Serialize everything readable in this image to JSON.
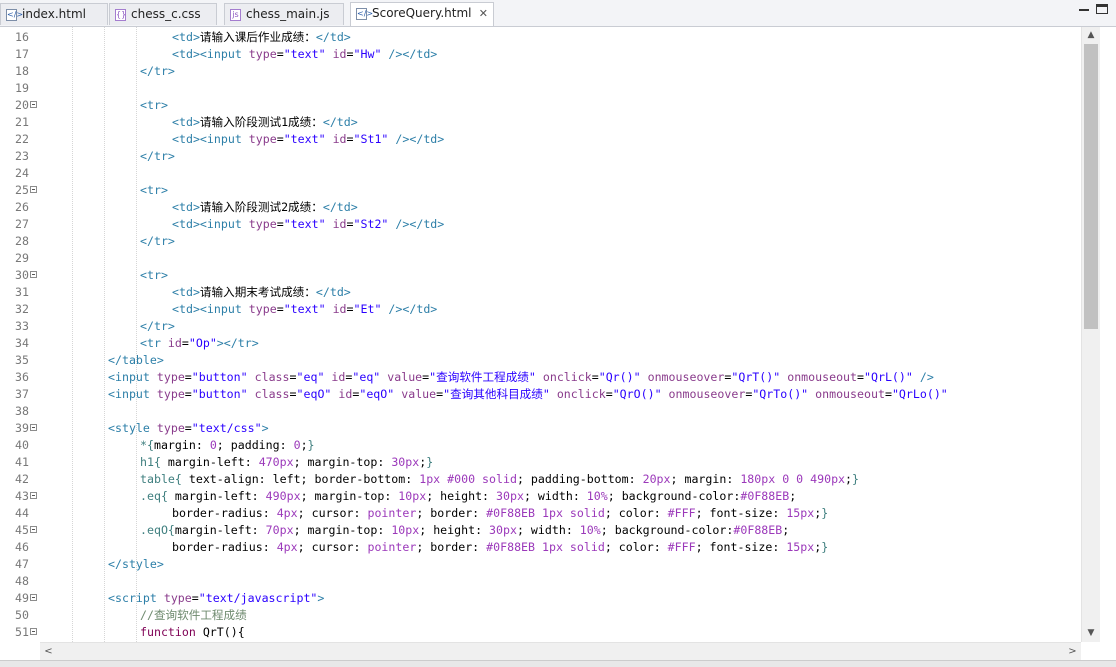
{
  "tabs": [
    {
      "label": "index.html",
      "icon": "html-file-icon"
    },
    {
      "label": "chess_c.css",
      "icon": "css-file-icon"
    },
    {
      "label": "chess_main.js",
      "icon": "js-file-icon"
    },
    {
      "label": "ScoreQuery.html",
      "icon": "html-file-icon",
      "active": true
    }
  ],
  "close_glyph": "✕",
  "scroll_up": "▲",
  "scroll_down": "▼",
  "scroll_left": "<",
  "scroll_right": ">",
  "lines": [
    {
      "n": "16",
      "fold": false,
      "indent": 4,
      "segs": [
        [
          "t",
          "<td>"
        ],
        [
          "tx",
          "请输入课后作业成绩："
        ],
        [
          "t",
          "</td>"
        ]
      ]
    },
    {
      "n": "17",
      "fold": false,
      "indent": 4,
      "segs": [
        [
          "t",
          "<td><input "
        ],
        [
          "a",
          "type"
        ],
        [
          "tx",
          "="
        ],
        [
          "v",
          "\"text\""
        ],
        [
          "tx",
          " "
        ],
        [
          "a",
          "id"
        ],
        [
          "tx",
          "="
        ],
        [
          "v",
          "\"Hw\""
        ],
        [
          "tx",
          " "
        ],
        [
          "t",
          "/></td>"
        ]
      ]
    },
    {
      "n": "18",
      "fold": false,
      "indent": 3,
      "segs": [
        [
          "t",
          "</tr>"
        ]
      ]
    },
    {
      "n": "19",
      "fold": false,
      "indent": 0,
      "segs": []
    },
    {
      "n": "20",
      "fold": true,
      "indent": 3,
      "segs": [
        [
          "t",
          "<tr>"
        ]
      ]
    },
    {
      "n": "21",
      "fold": false,
      "indent": 4,
      "segs": [
        [
          "t",
          "<td>"
        ],
        [
          "tx",
          "请输入阶段测试1成绩："
        ],
        [
          "t",
          "</td>"
        ]
      ]
    },
    {
      "n": "22",
      "fold": false,
      "indent": 4,
      "segs": [
        [
          "t",
          "<td><input "
        ],
        [
          "a",
          "type"
        ],
        [
          "tx",
          "="
        ],
        [
          "v",
          "\"text\""
        ],
        [
          "tx",
          " "
        ],
        [
          "a",
          "id"
        ],
        [
          "tx",
          "="
        ],
        [
          "v",
          "\"St1\""
        ],
        [
          "tx",
          " "
        ],
        [
          "t",
          "/></td>"
        ]
      ]
    },
    {
      "n": "23",
      "fold": false,
      "indent": 3,
      "segs": [
        [
          "t",
          "</tr>"
        ]
      ]
    },
    {
      "n": "24",
      "fold": false,
      "indent": 0,
      "segs": []
    },
    {
      "n": "25",
      "fold": true,
      "indent": 3,
      "segs": [
        [
          "t",
          "<tr>"
        ]
      ]
    },
    {
      "n": "26",
      "fold": false,
      "indent": 4,
      "segs": [
        [
          "t",
          "<td>"
        ],
        [
          "tx",
          "请输入阶段测试2成绩："
        ],
        [
          "t",
          "</td>"
        ]
      ]
    },
    {
      "n": "27",
      "fold": false,
      "indent": 4,
      "segs": [
        [
          "t",
          "<td><input "
        ],
        [
          "a",
          "type"
        ],
        [
          "tx",
          "="
        ],
        [
          "v",
          "\"text\""
        ],
        [
          "tx",
          " "
        ],
        [
          "a",
          "id"
        ],
        [
          "tx",
          "="
        ],
        [
          "v",
          "\"St2\""
        ],
        [
          "tx",
          " "
        ],
        [
          "t",
          "/></td>"
        ]
      ]
    },
    {
      "n": "28",
      "fold": false,
      "indent": 3,
      "segs": [
        [
          "t",
          "</tr>"
        ]
      ]
    },
    {
      "n": "29",
      "fold": false,
      "indent": 0,
      "segs": []
    },
    {
      "n": "30",
      "fold": true,
      "indent": 3,
      "segs": [
        [
          "t",
          "<tr>"
        ]
      ]
    },
    {
      "n": "31",
      "fold": false,
      "indent": 4,
      "segs": [
        [
          "t",
          "<td>"
        ],
        [
          "tx",
          "请输入期末考试成绩："
        ],
        [
          "t",
          "</td>"
        ]
      ]
    },
    {
      "n": "32",
      "fold": false,
      "indent": 4,
      "segs": [
        [
          "t",
          "<td><input "
        ],
        [
          "a",
          "type"
        ],
        [
          "tx",
          "="
        ],
        [
          "v",
          "\"text\""
        ],
        [
          "tx",
          " "
        ],
        [
          "a",
          "id"
        ],
        [
          "tx",
          "="
        ],
        [
          "v",
          "\"Et\""
        ],
        [
          "tx",
          " "
        ],
        [
          "t",
          "/></td>"
        ]
      ]
    },
    {
      "n": "33",
      "fold": false,
      "indent": 3,
      "segs": [
        [
          "t",
          "</tr>"
        ]
      ]
    },
    {
      "n": "34",
      "fold": false,
      "indent": 3,
      "segs": [
        [
          "t",
          "<tr "
        ],
        [
          "a",
          "id"
        ],
        [
          "tx",
          "="
        ],
        [
          "v",
          "\"Op\""
        ],
        [
          "t",
          "></tr>"
        ]
      ]
    },
    {
      "n": "35",
      "fold": false,
      "indent": 2,
      "segs": [
        [
          "t",
          "</table>"
        ]
      ]
    },
    {
      "n": "36",
      "fold": false,
      "indent": 2,
      "segs": [
        [
          "t",
          "<input "
        ],
        [
          "a",
          "type"
        ],
        [
          "tx",
          "="
        ],
        [
          "v",
          "\"button\""
        ],
        [
          "tx",
          " "
        ],
        [
          "a",
          "class"
        ],
        [
          "tx",
          "="
        ],
        [
          "v",
          "\"eq\""
        ],
        [
          "tx",
          " "
        ],
        [
          "a",
          "id"
        ],
        [
          "tx",
          "="
        ],
        [
          "v",
          "\"eq\""
        ],
        [
          "tx",
          " "
        ],
        [
          "a",
          "value"
        ],
        [
          "tx",
          "="
        ],
        [
          "v",
          "\"查询软件工程成绩\""
        ],
        [
          "tx",
          " "
        ],
        [
          "a",
          "onclick"
        ],
        [
          "tx",
          "="
        ],
        [
          "v",
          "\"Qr()\""
        ],
        [
          "tx",
          " "
        ],
        [
          "a",
          "onmouseover"
        ],
        [
          "tx",
          "="
        ],
        [
          "v",
          "\"QrT()\""
        ],
        [
          "tx",
          " "
        ],
        [
          "a",
          "onmouseout"
        ],
        [
          "tx",
          "="
        ],
        [
          "v",
          "\"QrL()\""
        ],
        [
          "tx",
          " "
        ],
        [
          "t",
          "/>"
        ]
      ]
    },
    {
      "n": "37",
      "fold": false,
      "indent": 2,
      "segs": [
        [
          "t",
          "<input "
        ],
        [
          "a",
          "type"
        ],
        [
          "tx",
          "="
        ],
        [
          "v",
          "\"button\""
        ],
        [
          "tx",
          " "
        ],
        [
          "a",
          "class"
        ],
        [
          "tx",
          "="
        ],
        [
          "v",
          "\"eqO\""
        ],
        [
          "tx",
          " "
        ],
        [
          "a",
          "id"
        ],
        [
          "tx",
          "="
        ],
        [
          "v",
          "\"eqO\""
        ],
        [
          "tx",
          " "
        ],
        [
          "a",
          "value"
        ],
        [
          "tx",
          "="
        ],
        [
          "v",
          "\"查询其他科目成绩\""
        ],
        [
          "tx",
          " "
        ],
        [
          "a",
          "onclick"
        ],
        [
          "tx",
          "="
        ],
        [
          "v",
          "\"QrO()\""
        ],
        [
          "tx",
          " "
        ],
        [
          "a",
          "onmouseover"
        ],
        [
          "tx",
          "="
        ],
        [
          "v",
          "\"QrTo()\""
        ],
        [
          "tx",
          " "
        ],
        [
          "a",
          "onmouseout"
        ],
        [
          "tx",
          "="
        ],
        [
          "v",
          "\"QrLo()\""
        ]
      ]
    },
    {
      "n": "38",
      "fold": false,
      "indent": 0,
      "segs": []
    },
    {
      "n": "39",
      "fold": true,
      "indent": 2,
      "segs": [
        [
          "t",
          "<style "
        ],
        [
          "a",
          "type"
        ],
        [
          "tx",
          "="
        ],
        [
          "v",
          "\"text/css\""
        ],
        [
          "t",
          ">"
        ]
      ]
    },
    {
      "n": "40",
      "fold": false,
      "indent": 3,
      "segs": [
        [
          "cs",
          "*{"
        ],
        [
          "tx",
          "margin: "
        ],
        [
          "n",
          "0"
        ],
        [
          "tx",
          "; padding: "
        ],
        [
          "n",
          "0"
        ],
        [
          "tx",
          ";"
        ],
        [
          "cs",
          "}"
        ]
      ]
    },
    {
      "n": "41",
      "fold": false,
      "indent": 3,
      "segs": [
        [
          "cs",
          "h1{"
        ],
        [
          "tx",
          " margin-left: "
        ],
        [
          "n",
          "470px"
        ],
        [
          "tx",
          "; margin-top: "
        ],
        [
          "n",
          "30px"
        ],
        [
          "tx",
          ";"
        ],
        [
          "cs",
          "}"
        ]
      ]
    },
    {
      "n": "42",
      "fold": false,
      "indent": 3,
      "segs": [
        [
          "cs",
          "table{"
        ],
        [
          "tx",
          " text-align: left; border-bottom: "
        ],
        [
          "n",
          "1px #000 solid"
        ],
        [
          "tx",
          "; padding-bottom: "
        ],
        [
          "n",
          "20px"
        ],
        [
          "tx",
          "; margin: "
        ],
        [
          "n",
          "180px 0 0 490px"
        ],
        [
          "tx",
          ";"
        ],
        [
          "cs",
          "}"
        ]
      ]
    },
    {
      "n": "43",
      "fold": true,
      "indent": 3,
      "segs": [
        [
          "cs",
          ".eq{"
        ],
        [
          "tx",
          " margin-left: "
        ],
        [
          "n",
          "490px"
        ],
        [
          "tx",
          "; margin-top: "
        ],
        [
          "n",
          "10px"
        ],
        [
          "tx",
          "; height: "
        ],
        [
          "n",
          "30px"
        ],
        [
          "tx",
          "; width: "
        ],
        [
          "n",
          "10%"
        ],
        [
          "tx",
          "; background-color:"
        ],
        [
          "n",
          "#0F88EB"
        ],
        [
          "tx",
          ";"
        ]
      ]
    },
    {
      "n": "44",
      "fold": false,
      "indent": 4,
      "segs": [
        [
          "tx",
          "border-radius: "
        ],
        [
          "n",
          "4px"
        ],
        [
          "tx",
          "; cursor: "
        ],
        [
          "n",
          "pointer"
        ],
        [
          "tx",
          "; border: "
        ],
        [
          "n",
          "#0F88EB 1px solid"
        ],
        [
          "tx",
          "; color: "
        ],
        [
          "n",
          "#FFF"
        ],
        [
          "tx",
          "; font-size: "
        ],
        [
          "n",
          "15px"
        ],
        [
          "tx",
          ";"
        ],
        [
          "cs",
          "}"
        ]
      ]
    },
    {
      "n": "45",
      "fold": true,
      "indent": 3,
      "segs": [
        [
          "cs",
          ".eqO{"
        ],
        [
          "tx",
          "margin-left: "
        ],
        [
          "n",
          "70px"
        ],
        [
          "tx",
          "; margin-top: "
        ],
        [
          "n",
          "10px"
        ],
        [
          "tx",
          "; height: "
        ],
        [
          "n",
          "30px"
        ],
        [
          "tx",
          "; width: "
        ],
        [
          "n",
          "10%"
        ],
        [
          "tx",
          "; background-color:"
        ],
        [
          "n",
          "#0F88EB"
        ],
        [
          "tx",
          ";"
        ]
      ]
    },
    {
      "n": "46",
      "fold": false,
      "indent": 4,
      "segs": [
        [
          "tx",
          "border-radius: "
        ],
        [
          "n",
          "4px"
        ],
        [
          "tx",
          "; cursor: "
        ],
        [
          "n",
          "pointer"
        ],
        [
          "tx",
          "; border: "
        ],
        [
          "n",
          "#0F88EB 1px solid"
        ],
        [
          "tx",
          "; color: "
        ],
        [
          "n",
          "#FFF"
        ],
        [
          "tx",
          "; font-size: "
        ],
        [
          "n",
          "15px"
        ],
        [
          "tx",
          ";"
        ],
        [
          "cs",
          "}"
        ]
      ]
    },
    {
      "n": "47",
      "fold": false,
      "indent": 2,
      "segs": [
        [
          "t",
          "</style>"
        ]
      ]
    },
    {
      "n": "48",
      "fold": false,
      "indent": 0,
      "segs": []
    },
    {
      "n": "49",
      "fold": true,
      "indent": 2,
      "segs": [
        [
          "t",
          "<script "
        ],
        [
          "a",
          "type"
        ],
        [
          "tx",
          "="
        ],
        [
          "v",
          "\"text/javascript\""
        ],
        [
          "t",
          ">"
        ]
      ]
    },
    {
      "n": "50",
      "fold": false,
      "indent": 3,
      "segs": [
        [
          "cm",
          "//查询软件工程成绩"
        ]
      ]
    },
    {
      "n": "51",
      "fold": true,
      "indent": 3,
      "segs": [
        [
          "kw",
          "function "
        ],
        [
          "tx",
          "QrT(){"
        ]
      ]
    }
  ]
}
